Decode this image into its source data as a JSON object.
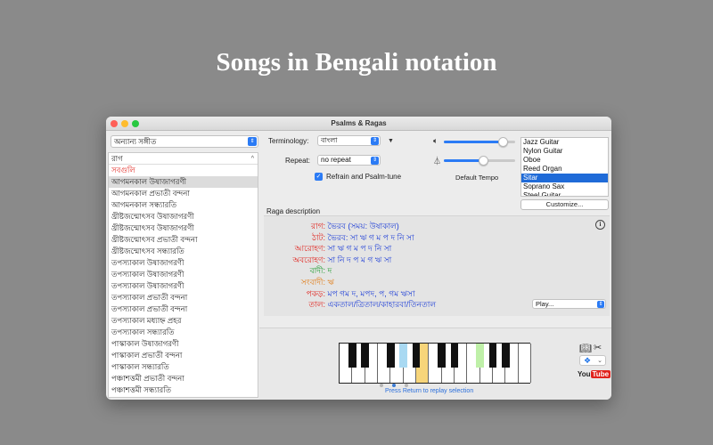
{
  "headline": "Songs in Bengali notation",
  "window": {
    "title": "Psalms & Ragas"
  },
  "left": {
    "category_select": "অন্যান্য সঙ্গীত",
    "list_header": "রাগ",
    "list_items": [
      "সবগুলি",
      "আগমনকাল উষাজাগরণী",
      "আগমনকাল প্রভাতী বন্দনা",
      "আগমনকাল সন্ধ্যারতি",
      "খ্রীষ্টজন্মোৎসব উষাজাগরণী",
      "খ্রীষ্টজন্মোৎসব উষাজাগরণী",
      "খ্রীষ্টজন্মোৎসব প্রভাতী বন্দনা",
      "খ্রীষ্টজন্মোৎসব সন্ধ্যারতি",
      "তপস্যাকাল উষাজাগরণী",
      "তপস্যাকাল উষাজাগরণী",
      "তপস্যাকাল উষাজাগরণী",
      "তপস্যাকাল প্রভাতী বন্দনা",
      "তপস্যাকাল প্রভাতী বন্দনা",
      "তপস্যাকাল মধ্যাহ্ন প্রহর",
      "তপস্যাকাল সন্ধ্যারতি",
      "পাস্কাকাল উষাজাগরণী",
      "পাস্কাকাল প্রভাতী বন্দনা",
      "পাস্কাকাল সন্ধ্যারতি",
      "পঞ্চাশত্তমী প্রভাতী বন্দনা",
      "পঞ্চাশত্তমী সন্ধ্যারতি"
    ]
  },
  "controls": {
    "terminology_label": "Terminology:",
    "terminology_value": "বাংলা",
    "repeat_label": "Repeat:",
    "repeat_value": "no repeat",
    "refrain_label": "Refrain and Psalm-tune",
    "refrain_checked": true,
    "volume_level": 0.82,
    "tempo_level": 0.55,
    "default_tempo_label": "Default Tempo",
    "customize_label": "Customize..."
  },
  "instruments": {
    "items": [
      "Jazz Guitar",
      "Nylon Guitar",
      "Oboe",
      "Reed Organ",
      "Sitar",
      "Soprano Sax",
      "Steel Guitar"
    ],
    "selected": "Sitar"
  },
  "raga": {
    "section_title": "Raga description",
    "rows": [
      {
        "k": "রাগ:",
        "v": "ভৈরব (সময়: উষাকাল)"
      },
      {
        "k": "ঠাট:",
        "v": "ভৈরব: সা ঋ গ ম প দ নি সা"
      },
      {
        "k": "আরোহণ:",
        "v": "সা ঋ গ ম প দ নি সা"
      },
      {
        "k": "অবরোহণ:",
        "v": "সা নি দ প ম গ ঋ সা"
      },
      {
        "k": "বাদী:",
        "v": "দ"
      },
      {
        "k": "সংবাদী:",
        "v": "ঋ"
      },
      {
        "k": "পকড়:",
        "v": "মপ গম দ, মপদ, প, গম ঋসা"
      },
      {
        "k": "তাল:",
        "v": "একতাল/ত্রিতাল/কাহারবা/তিনতাল"
      }
    ],
    "play_label": "Play..."
  },
  "keyboard": {
    "replay_hint": "Press Return to replay selection",
    "page_dots": 3,
    "active_dot": 2
  },
  "colors": {
    "accent": "#2b7bf5",
    "label_red": "#e0231d",
    "value_blue": "#1f3fd6",
    "vadi_green": "#1a9a2a",
    "samvadi_orange": "#e07a12",
    "key_blue": "#a9d9f2",
    "key_orange": "#f7d57a",
    "key_green": "#bff0a8"
  },
  "icons": {
    "speaker": "speaker-icon",
    "metronome": "metronome-icon",
    "book": "book-icon",
    "tools": "tools-icon",
    "dropbox": "dropbox-icon",
    "youtube": "youtube-icon"
  },
  "youtube": {
    "you": "You",
    "tube": "Tube"
  }
}
